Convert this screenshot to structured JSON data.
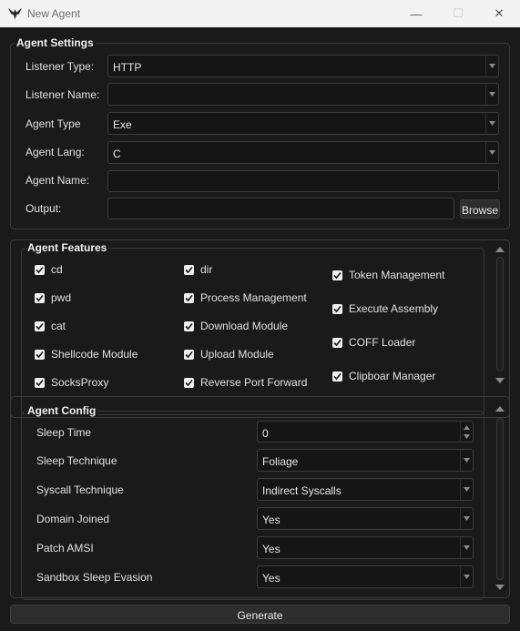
{
  "window": {
    "title": "New Agent",
    "minimize_glyph": "—",
    "maximize_glyph": "☐",
    "close_glyph": "✕"
  },
  "agent_settings": {
    "title": "Agent Settings",
    "listener_type": {
      "label": "Listener Type:",
      "value": "HTTP"
    },
    "listener_name": {
      "label": "Listener Name:",
      "value": ""
    },
    "agent_type": {
      "label": "Agent Type",
      "value": "Exe"
    },
    "agent_lang": {
      "label": "Agent Lang:",
      "value": "C"
    },
    "agent_name": {
      "label": "Agent Name:",
      "value": ""
    },
    "output": {
      "label": "Output:",
      "value": "",
      "browse_label": "Browse"
    }
  },
  "agent_features": {
    "title": "Agent Features",
    "items": [
      {
        "label": "cd",
        "checked": true
      },
      {
        "label": "pwd",
        "checked": true
      },
      {
        "label": "cat",
        "checked": true
      },
      {
        "label": "Shellcode Module",
        "checked": true
      },
      {
        "label": "SocksProxy",
        "checked": true
      },
      {
        "label": "dir",
        "checked": true
      },
      {
        "label": "Process Management",
        "checked": true
      },
      {
        "label": "Download Module",
        "checked": true
      },
      {
        "label": "Upload Module",
        "checked": true
      },
      {
        "label": "Reverse Port Forward",
        "checked": true
      },
      {
        "label": "Token Management",
        "checked": true
      },
      {
        "label": "Execute Assembly",
        "checked": true
      },
      {
        "label": "COFF Loader",
        "checked": true
      },
      {
        "label": "Clipboar Manager",
        "checked": true
      }
    ]
  },
  "agent_config": {
    "title": "Agent Config",
    "sleep_time": {
      "label": "Sleep Time",
      "value": "0"
    },
    "sleep_technique": {
      "label": "Sleep Technique",
      "value": "Foliage"
    },
    "syscall_technique": {
      "label": "Syscall Technique",
      "value": "Indirect Syscalls"
    },
    "domain_joined": {
      "label": "Domain Joined",
      "value": "Yes"
    },
    "patch_amsi": {
      "label": "Patch AMSI",
      "value": "Yes"
    },
    "sandbox_sleep_evasion": {
      "label": "Sandbox Sleep Evasion",
      "value": "Yes"
    }
  },
  "generate_label": "Generate",
  "colors": {
    "background": "#1a1a1a",
    "field": "#151515",
    "border": "#3a3a3a",
    "titlebar": "#f3f3f3",
    "checkbox": "#efefef"
  },
  "icons": [
    "app-logo-icon",
    "minimize-icon",
    "maximize-icon",
    "close-icon",
    "chevron-down-icon",
    "chevron-up-icon",
    "check-icon"
  ]
}
